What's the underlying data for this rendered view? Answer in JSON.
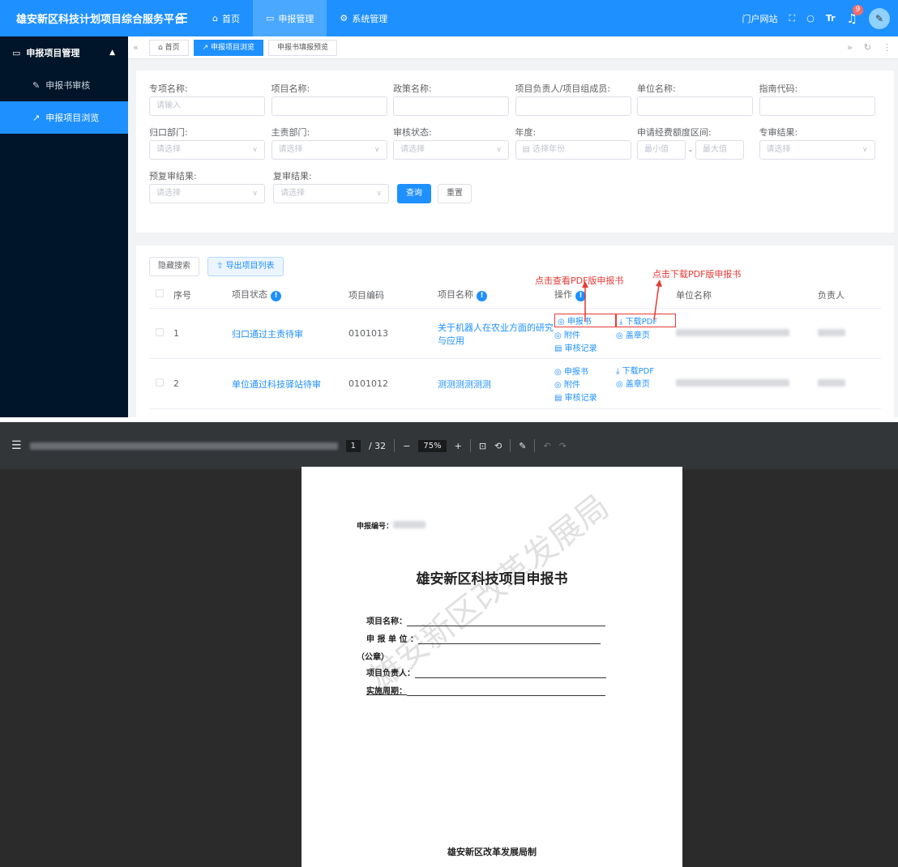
{
  "topbar": {
    "app_title": "雄安新区科技计划项目综合服务平台",
    "menu_icon": "menu-icon",
    "nav": [
      {
        "label": "首页",
        "icon": "home-icon"
      },
      {
        "label": "申报管理",
        "icon": "monitor-icon"
      },
      {
        "label": "系统管理",
        "icon": "gear-icon"
      }
    ],
    "portal_label": "门户网站",
    "notification_count": "9"
  },
  "sidebar": {
    "group_label": "申报项目管理",
    "items": [
      {
        "label": "申报书审核"
      },
      {
        "label": "申报项目浏览"
      }
    ]
  },
  "tabs": [
    "首页",
    "申报项目浏览",
    "申报书填报预览"
  ],
  "filters": {
    "row1": [
      {
        "label": "专项名称:",
        "placeholder": "请输入"
      },
      {
        "label": "项目名称:",
        "placeholder": ""
      },
      {
        "label": "政策名称:",
        "placeholder": ""
      },
      {
        "label": "项目负责人/项目组成员:",
        "placeholder": ""
      },
      {
        "label": "单位名称:",
        "placeholder": ""
      },
      {
        "label": "指南代码:",
        "placeholder": ""
      }
    ],
    "row2": [
      {
        "label": "归口部门:",
        "placeholder": "请选择"
      },
      {
        "label": "主责部门:",
        "placeholder": "请选择"
      },
      {
        "label": "审核状态:",
        "placeholder": "请选择"
      },
      {
        "label": "年度:",
        "placeholder": "选择年份"
      }
    ],
    "budget_label": "申请经费额度区间:",
    "budget_min": "最小值",
    "budget_sep": "-",
    "budget_max": "最大值",
    "special_label": "专审结果:",
    "special_placeholder": "请选择",
    "row3": [
      {
        "label": "预复审结果:",
        "placeholder": "请选择"
      },
      {
        "label": "复审结果:",
        "placeholder": "请选择"
      }
    ],
    "query_label": "查询",
    "reset_label": "重置"
  },
  "table": {
    "hide_search": "隐藏搜索",
    "export": "导出项目列表",
    "headers": [
      "序号",
      "项目状态",
      "项目编码",
      "项目名称",
      "操作",
      "单位名称",
      "负责人"
    ],
    "rows": [
      {
        "no": "1",
        "status": "归口通过主责待审",
        "code": "0101013",
        "name": "关于机器人在农业方面的研究与应用"
      },
      {
        "no": "2",
        "status": "单位通过科技驿站待审",
        "code": "0101012",
        "name": "测测测测测测"
      }
    ],
    "ops": {
      "view": "申报书",
      "attach": "附件",
      "records": "审核记录",
      "download": "下载PDF",
      "seal": "盖章页"
    }
  },
  "annotations": {
    "view_pdf": "点击查看PDF版申报书",
    "download_pdf": "点击下载PDF版申报书"
  },
  "viewer": {
    "page_current": "1",
    "page_total": "/ 32",
    "zoom": "75%"
  },
  "document": {
    "application_no_label": "申报编号：",
    "title": "雄安新区科技项目申报书",
    "fields": [
      "项目名称：",
      "申 报 单 位 ：",
      "（公章）",
      "项目负责人：",
      "实施周期："
    ],
    "issuer": "雄安新区改革发展局制",
    "watermark": "雄安新区改革发展局"
  }
}
